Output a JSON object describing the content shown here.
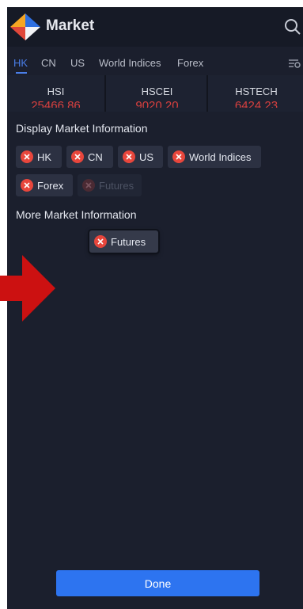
{
  "header": {
    "title": "Market",
    "logo_icon": "market-logo-icon",
    "search_icon": "search-icon"
  },
  "tabs": [
    {
      "label": "HK",
      "active": true
    },
    {
      "label": "CN",
      "active": false
    },
    {
      "label": "US",
      "active": false
    },
    {
      "label": "World Indices",
      "active": false
    },
    {
      "label": "Forex",
      "active": false
    }
  ],
  "indices": [
    {
      "name": "HSI",
      "value": "25466.86"
    },
    {
      "name": "HSCEI",
      "value": "9020.20"
    },
    {
      "name": "HSTECH",
      "value": "6424.23"
    }
  ],
  "display_section": {
    "title": "Display Market Information",
    "chips": [
      {
        "label": "HK"
      },
      {
        "label": "CN"
      },
      {
        "label": "US"
      },
      {
        "label": "World Indices"
      },
      {
        "label": "Forex"
      },
      {
        "label": "Futures",
        "disabled": true
      }
    ]
  },
  "more_section": {
    "title": "More Market Information",
    "chips": [
      {
        "label": "Futures",
        "dragging": true
      }
    ]
  },
  "done_label": "Done",
  "colors": {
    "accent": "#2d74f0",
    "remove": "#e8463c",
    "price_down": "#d8403f",
    "annotation_arrow": "#cc1111"
  }
}
